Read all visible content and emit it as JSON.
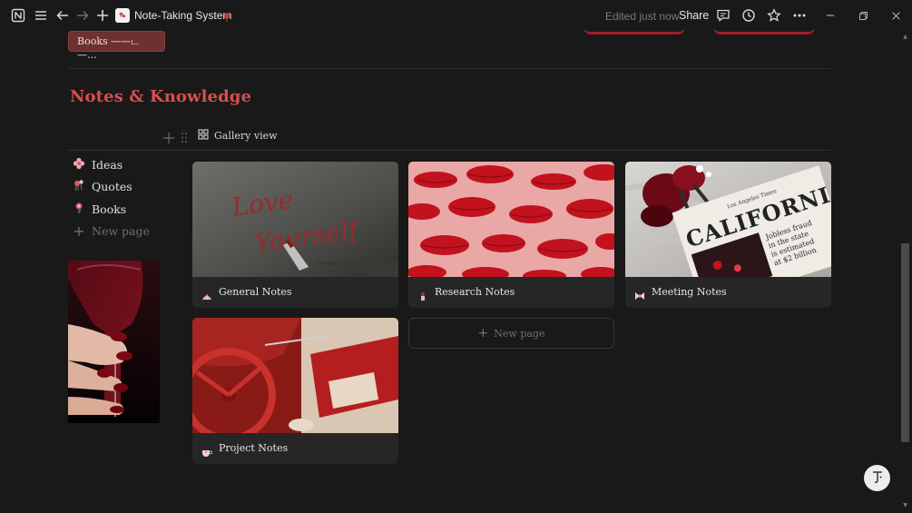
{
  "topbar": {
    "page_title": "Note-Taking System",
    "edited_label": "Edited just now",
    "share_label": "Share"
  },
  "top": {
    "books_button_label": "Books ——ட—..."
  },
  "section": {
    "title": "Notes & Knowledge"
  },
  "view": {
    "tab_label": "Gallery view"
  },
  "sidebar": {
    "items": [
      {
        "label": "Ideas",
        "icon": "pink-flower-icon"
      },
      {
        "label": "Quotes",
        "icon": "rose-bouquet-icon"
      },
      {
        "label": "Books",
        "icon": "rose-icon"
      }
    ],
    "new_page_label": "New page"
  },
  "gallery": {
    "cards": [
      {
        "title": "General Notes",
        "icon": "shell-icon"
      },
      {
        "title": "Research Notes",
        "icon": "lipstick-icon"
      },
      {
        "title": "Meeting Notes",
        "icon": "bow-icon"
      },
      {
        "title": "Project Notes",
        "icon": "teacup-icon"
      }
    ],
    "new_page_label": "New page"
  },
  "covers": {
    "general_text_line1": "Love",
    "general_text_line2": "Yourself",
    "newspaper_masthead": "Los Angeles Times",
    "newspaper_headline": "CALIFORNIA",
    "newspaper_sub": "Jobless fraud in the state is estimated at $2 billion"
  },
  "colors": {
    "accent": "#d64f4f",
    "background": "#191919",
    "card": "#262626",
    "books_button": "#6e3030"
  }
}
